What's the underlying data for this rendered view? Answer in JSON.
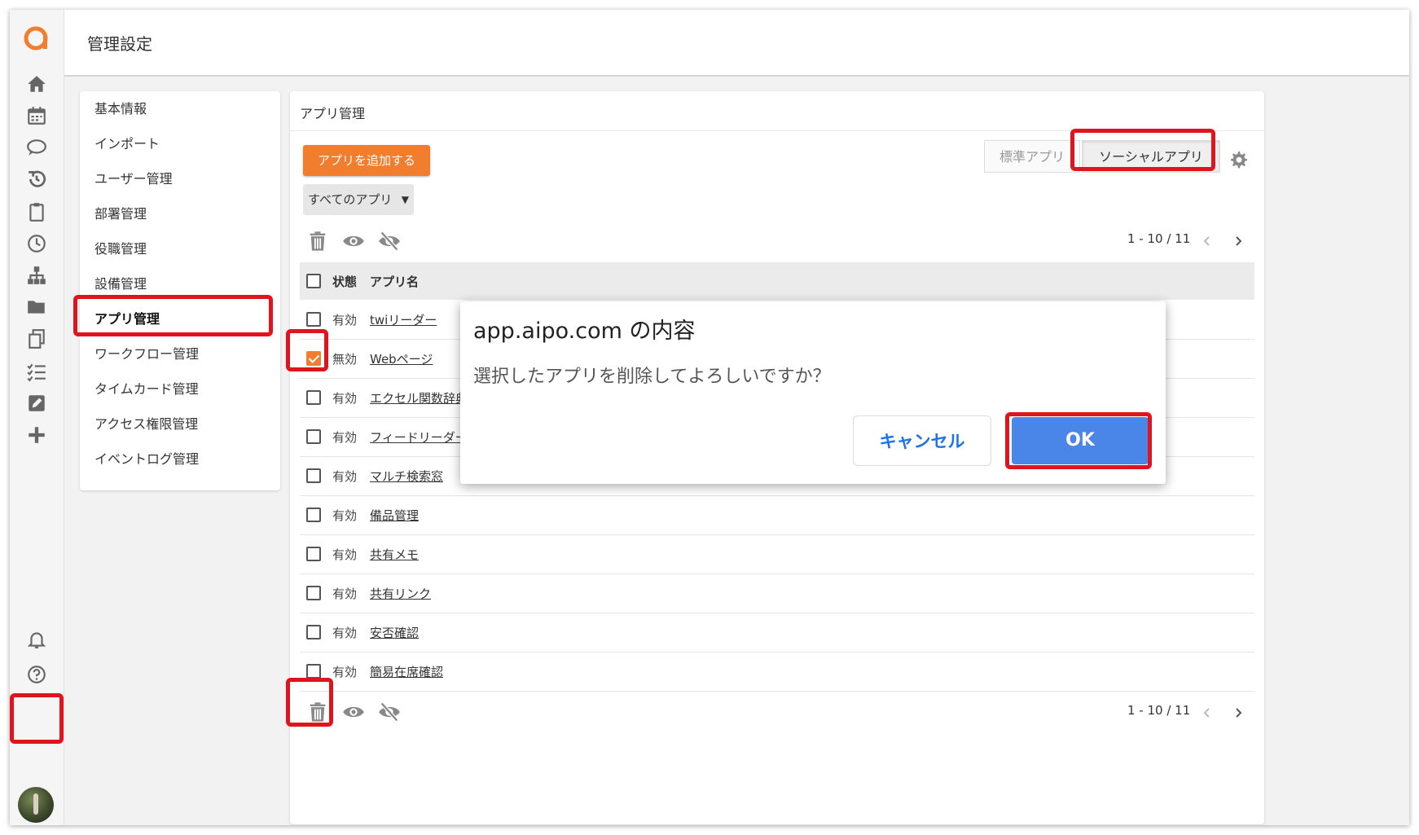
{
  "header": {
    "title": "管理設定"
  },
  "menu": {
    "items": [
      {
        "label": "基本情報"
      },
      {
        "label": "インポート"
      },
      {
        "label": "ユーザー管理"
      },
      {
        "label": "部署管理"
      },
      {
        "label": "役職管理"
      },
      {
        "label": "設備管理"
      },
      {
        "label": "アプリ管理",
        "active": true
      },
      {
        "label": "ワークフロー管理"
      },
      {
        "label": "タイムカード管理"
      },
      {
        "label": "アクセス権限管理"
      },
      {
        "label": "イベントログ管理"
      }
    ]
  },
  "panel": {
    "title": "アプリ管理",
    "add_button": "アプリを追加する",
    "filter": {
      "selected": "すべてのアプリ"
    },
    "tabs": {
      "standard": "標準アプリ",
      "social": "ソーシャルアプリ"
    },
    "pager": {
      "top": "1 - 10 / 11",
      "bottom": "1 - 10 / 11"
    },
    "table": {
      "headers": {
        "status": "状態",
        "name": "アプリ名"
      },
      "rows": [
        {
          "status": "有効",
          "name": "twiリーダー",
          "checked": false
        },
        {
          "status": "無効",
          "name": "Webページ",
          "checked": true
        },
        {
          "status": "有効",
          "name": "エクセル関数辞典",
          "checked": false
        },
        {
          "status": "有効",
          "name": "フィードリーダー",
          "checked": false
        },
        {
          "status": "有効",
          "name": "マルチ検索窓",
          "checked": false
        },
        {
          "status": "有効",
          "name": "備品管理",
          "checked": false
        },
        {
          "status": "有効",
          "name": "共有メモ",
          "checked": false
        },
        {
          "status": "有効",
          "name": "共有リンク",
          "checked": false
        },
        {
          "status": "有効",
          "name": "安否確認",
          "checked": false
        },
        {
          "status": "有効",
          "name": "簡易在席確認",
          "checked": false
        }
      ]
    }
  },
  "dialog": {
    "title": "app.aipo.com の内容",
    "message": "選択したアプリを削除してよろしいですか？",
    "cancel": "キャンセル",
    "ok": "OK"
  },
  "rail_icons": [
    "home-icon",
    "calendar-icon",
    "chat-icon",
    "history-icon",
    "clipboard-icon",
    "clock-icon",
    "org-chart-icon",
    "folder-icon",
    "copy-icon",
    "todo-list-icon",
    "edit-icon",
    "plus-icon",
    "bell-icon",
    "help-icon"
  ],
  "colors": {
    "accent": "#f07e2e",
    "highlight": "#e0141c",
    "ok_button": "#4a86e8"
  }
}
